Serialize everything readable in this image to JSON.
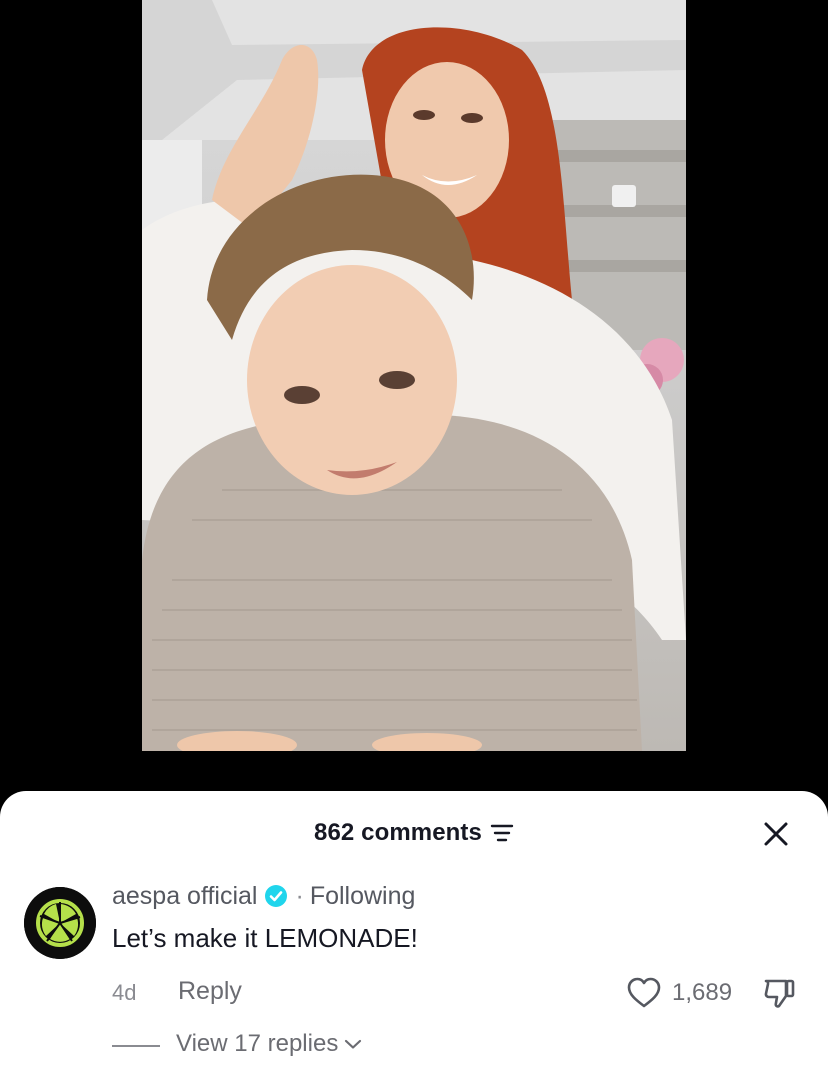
{
  "video": {
    "description_icon": "video-frame-image"
  },
  "comments_sheet": {
    "count_label": "862 comments",
    "sort_icon": "filter-lines-icon",
    "close_icon": "close-x-icon"
  },
  "comment": {
    "username": "aespa official",
    "verified_icon": "verified-badge-icon",
    "separator": "·",
    "following_label": "Following",
    "text": "Let’s make it LEMONADE!",
    "time": "4d",
    "reply_label": "Reply",
    "like_icon": "heart-icon",
    "like_count": "1,689",
    "dislike_icon": "thumbs-down-icon",
    "view_replies_label": "View 17 replies",
    "view_replies_icon": "chevron-down-icon"
  },
  "colors": {
    "verified": "#20d5ec",
    "avatar_bg": "#0d0d0d",
    "avatar_accent": "#b5e04a",
    "sheet_bg": "#ffffff",
    "video_bg": "#000000"
  }
}
